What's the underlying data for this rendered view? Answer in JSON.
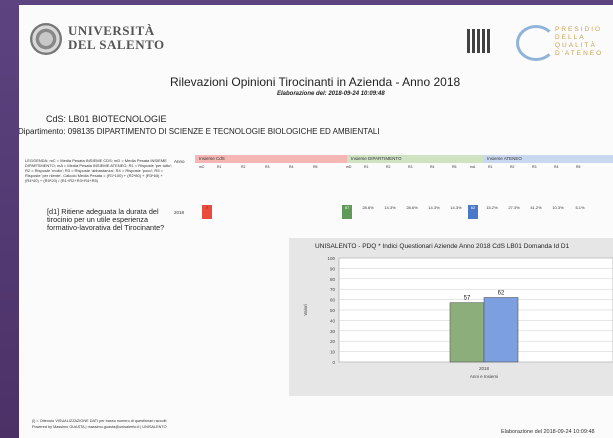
{
  "header": {
    "university_line1": "UNIVERSITÀ",
    "university_line2": "DEL SALENTO",
    "presidio_line1": "PRESIDIO",
    "presidio_line2": "DELLA QUALITÀ",
    "presidio_line3": "D'ATENEO"
  },
  "report": {
    "title": "Rilevazioni Opinioni Tirocinanti in Azienda - Anno 2018",
    "elaborazione": "Elaborazione del: 2018-09-24 10:09:48",
    "cds": "CdS: LB01 BIOTECNOLOGIE",
    "dipartimento": "Dipartimento: 098135 DIPARTIMENTO DI SCIENZE E TECNOLOGIE BIOLOGICHE ED AMBIENTALI"
  },
  "table": {
    "legend": "LEGGENDA: mC = Media Pesata INSIEME CDS; mD = Media Pesata INSIEME DIPARTIMENTO; mA = Media Pesata INSIEME ATENEO; R1 = Risposte 'per tutto'; R2 = Risposte 'molto'; R3 = Risposte 'abbastanza'; R4 = Risposte 'poco'; R5 = Risposte 'per niente'. Calcolo Media Pesata = (R1*100) + (R2*80) + (R3*60) + (R4*40) + (R5*20) / (R1+R2+R3+R4+R5)",
    "anno_label": "Anno",
    "group_cds": "Insieme CdS",
    "group_dip": "Insieme DIPARTIMENTO",
    "group_ateneo": "Insieme ATENEO",
    "cols_cds": [
      "mC",
      "R1",
      "R2",
      "R3",
      "R4",
      "R5"
    ],
    "cols_dip": [
      "mD",
      "R1",
      "R2",
      "R3",
      "R4",
      "R5"
    ],
    "cols_ateneo": [
      "mA",
      "R1",
      "R2",
      "R3",
      "R4",
      "R5"
    ],
    "question": "[d1] Ritiene adeguata la durata del tirocinio per un utile esperienza formativo-lavorativa del Tirocinante?",
    "year": "2018",
    "cds_mC": "?",
    "dip_values": [
      "57",
      "28.6%",
      "14.3%",
      "28.6%",
      "14.3%",
      "14.3%"
    ],
    "ateneo_values": [
      "62",
      "15.2%",
      "27.3%",
      "41.2%",
      "10.3%",
      "5.1%"
    ]
  },
  "chart_data": {
    "type": "bar",
    "title": "UNISALENTO - PDQ * Indici Questionari Aziende Anno 2018 CdS LB01 Domanda Id D1",
    "categories": [
      "2018"
    ],
    "series": [
      {
        "values": [
          57
        ],
        "color": "#8cae7a"
      },
      {
        "values": [
          62
        ],
        "color": "#7c9fe0"
      }
    ],
    "ylim": [
      0,
      100
    ],
    "yticks": [
      0,
      10,
      20,
      30,
      40,
      50,
      60,
      70,
      80,
      90,
      100
    ],
    "ylabel": "Valori",
    "xlabel": "Anni e Insiemi",
    "data_labels": [
      "57",
      "62"
    ]
  },
  "footer": {
    "line1": "(l) = Ottenuto VISUALIZZAZIONE DATI per basso numero di questionari raccolti",
    "line2": "Powered by Massimo GUASTA | massimo.guasta@unisalento.it | UNISALENTO",
    "right": "Elaborazione del 2018-09-24 10:09:48"
  }
}
